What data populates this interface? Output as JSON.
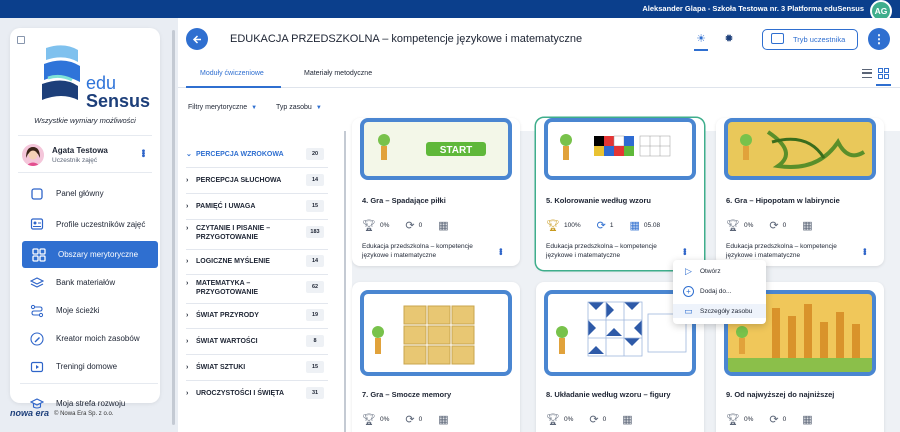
{
  "topbar": {
    "user_line": "Aleksander Glapa - Szkoła Testowa nr. 3 Platforma eduSensus",
    "avatar_initials": "AG",
    "color": "#0b3f8c"
  },
  "sidebar": {
    "logo_edu": "edu",
    "logo_sensus": "Sensus",
    "tagline": "Wszystkie wymiary możliwości",
    "profile": {
      "name": "Agata Testowa",
      "role": "Uczestnik zajęć"
    },
    "items": [
      {
        "label": "Panel główny",
        "icon": "home-icon"
      },
      {
        "label": "Profile uczestników zajęć",
        "icon": "user-icon"
      },
      {
        "label": "Obszary merytoryczne",
        "icon": "grid-icon",
        "active": true
      },
      {
        "label": "Bank materiałów",
        "icon": "layers-icon"
      },
      {
        "label": "Moje ścieżki",
        "icon": "path-icon"
      },
      {
        "label": "Kreator moich zasobów",
        "icon": "pencil-icon"
      },
      {
        "label": "Treningi domowe",
        "icon": "video-icon"
      },
      {
        "label": "Moja strefa rozwoju",
        "icon": "cap-icon"
      }
    ],
    "footer_brand": "nowa era",
    "footer_text": "© Nowa Era Sp. z o.o."
  },
  "header": {
    "title": "EDUKACJA PRZEDSZKOLNA – kompetencje językowe i matematyczne",
    "student_mode": "Tryb uczestnika"
  },
  "tabs": [
    {
      "label": "Moduły ćwiczeniowe",
      "active": true
    },
    {
      "label": "Materiały metodyczne",
      "active": false
    }
  ],
  "filters": [
    {
      "label": "Filtry merytoryczne"
    },
    {
      "label": "Typ zasobu"
    }
  ],
  "categories": [
    {
      "label": "PERCEPCJA WZROKOWA",
      "count": "20",
      "active": true
    },
    {
      "label": "PERCEPCJA SŁUCHOWA",
      "count": "14"
    },
    {
      "label": "PAMIĘĆ I UWAGA",
      "count": "15"
    },
    {
      "label": "CZYTANIE I PISANIE – PRZYGOTOWANIE",
      "count": "183"
    },
    {
      "label": "LOGICZNE MYŚLENIE",
      "count": "14"
    },
    {
      "label": "MATEMATYKA – PRZYGOTOWANIE",
      "count": "62"
    },
    {
      "label": "ŚWIAT PRZYRODY",
      "count": "19"
    },
    {
      "label": "ŚWIAT WARTOŚCI",
      "count": "8"
    },
    {
      "label": "ŚWIAT SZTUKI",
      "count": "15"
    },
    {
      "label": "UROCZYSTOŚCI I ŚWIĘTA",
      "count": "31"
    }
  ],
  "cards": [
    {
      "title": "4. Gra – Spadające piłki",
      "score": "0%",
      "attempts": "0",
      "date": "",
      "desc": "Edukacja przedszkolna – kompetencje językowe i matematyczne",
      "thumb_text": "START"
    },
    {
      "title": "5. Kolorowanie według wzoru",
      "score": "100%",
      "attempts": "1",
      "date": "05.08",
      "desc": "Edukacja przedszkolna – kompetencje językowe i matematyczne"
    },
    {
      "title": "6. Gra – Hipopotam w labiryncie",
      "score": "0%",
      "attempts": "0",
      "date": "",
      "desc": "Edukacja przedszkolna – kompetencje językowe i matematyczne"
    },
    {
      "title": "7. Gra – Smocze memory",
      "score": "0%",
      "attempts": "0",
      "date": ""
    },
    {
      "title": "8. Układanie według wzoru – figury",
      "score": "0%",
      "attempts": "0",
      "date": ""
    },
    {
      "title": "9. Od najwyższej do najniższej",
      "score": "0%",
      "attempts": "0",
      "date": ""
    }
  ],
  "context_menu": [
    {
      "label": "Otwórz",
      "icon": "play-icon"
    },
    {
      "label": "Dodaj do...",
      "icon": "plus-circle-icon"
    },
    {
      "label": "Szczegóły zasobu",
      "icon": "window-icon"
    }
  ]
}
